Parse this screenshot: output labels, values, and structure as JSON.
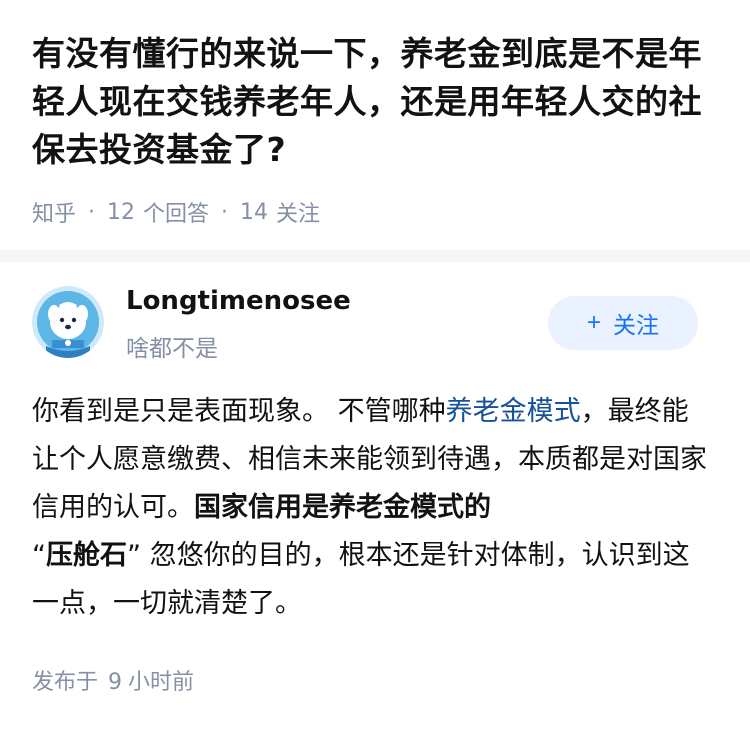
{
  "question": {
    "title": "有没有懂行的来说一下，养老金到底是不是年轻人现在交钱养老年人，还是用年轻人交的社保去投资基金了?",
    "source": "知乎",
    "separator": "·",
    "answer_count": "12",
    "answer_unit": "个回答",
    "follow_count": "14",
    "follow_unit": "关注"
  },
  "author": {
    "name": "Longtimenosee",
    "headline": "啥都不是",
    "avatar_icon": "dog-avatar-icon",
    "follow_label": "关注",
    "follow_plus": "+"
  },
  "answer": {
    "p1": "你看到是只是表面现象。 不管哪种",
    "link": "养老金模式",
    "p2": "，最终能让个人愿意缴费、相信未来能领到待遇，本质都是对国家信用的认可。",
    "bold1": "国家信用是养老金模式的",
    "quote_open": "“",
    "bold2": "压舱石",
    "quote_close": "”",
    "p3": " 忽悠你的目的，根本还是针对体制，认识到这一点，一切就清楚了。"
  },
  "post": {
    "prefix": "发布于",
    "number": "9",
    "suffix": "小时前"
  },
  "colors": {
    "accent": "#1772f6",
    "link": "#175199",
    "meta": "#8590a6",
    "follow_bg": "#eaf2ff"
  }
}
